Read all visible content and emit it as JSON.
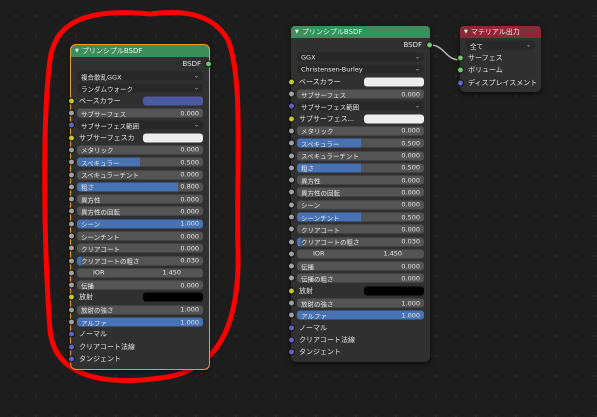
{
  "node1": {
    "title": "プリンシプルBSDF",
    "output": "BSDF",
    "dropdowns": [
      "複合散乱GGX",
      "ランダムウォーク"
    ],
    "rows": [
      {
        "type": "color",
        "label": "ベースカラー",
        "color": "#4d5aa0",
        "socket": "yellow"
      },
      {
        "type": "value",
        "label": "サブサーフェス",
        "value": "0.000",
        "fill": 0,
        "socket": "grey"
      },
      {
        "type": "vector",
        "label": "サブサーフェス範囲",
        "socket": "purple"
      },
      {
        "type": "color",
        "label": "サブサーフェスカ",
        "color": "#eeeeee",
        "socket": "yellow"
      },
      {
        "type": "value",
        "label": "メタリック",
        "value": "0.000",
        "fill": 0,
        "socket": "grey"
      },
      {
        "type": "value",
        "label": "スペキュラー",
        "value": "0.500",
        "fill": 0.5,
        "socket": "grey"
      },
      {
        "type": "value",
        "label": "スペキュラーチント",
        "value": "0.000",
        "fill": 0,
        "socket": "grey"
      },
      {
        "type": "value",
        "label": "粗さ",
        "value": "0.800",
        "fill": 0.8,
        "socket": "grey"
      },
      {
        "type": "value",
        "label": "異方性",
        "value": "0.000",
        "fill": 0,
        "socket": "grey"
      },
      {
        "type": "value",
        "label": "異方性の回転",
        "value": "0.000",
        "fill": 0,
        "socket": "grey"
      },
      {
        "type": "value",
        "label": "シーン",
        "value": "1.000",
        "fill": 1,
        "socket": "grey"
      },
      {
        "type": "value",
        "label": "シーンチント",
        "value": "0.000",
        "fill": 0,
        "socket": "grey"
      },
      {
        "type": "value",
        "label": "クリアコート",
        "value": "0.000",
        "fill": 0,
        "socket": "grey"
      },
      {
        "type": "value",
        "label": "クリアコートの粗さ",
        "value": "0.030",
        "fill": 0.03,
        "socket": "grey"
      },
      {
        "type": "value",
        "label": "IOR",
        "value": "1.450",
        "fill": 0,
        "socket": "grey",
        "center": true
      },
      {
        "type": "value",
        "label": "伝播",
        "value": "0.000",
        "fill": 0,
        "socket": "grey"
      },
      {
        "type": "color",
        "label": "放射",
        "color": "#000000",
        "socket": "yellow"
      },
      {
        "type": "value",
        "label": "放射の強さ",
        "value": "1.000",
        "fill": 0,
        "socket": "grey"
      },
      {
        "type": "value",
        "label": "アルファ",
        "value": "1.000",
        "fill": 1,
        "socket": "grey"
      },
      {
        "type": "plain",
        "label": "ノーマル",
        "socket": "purple"
      },
      {
        "type": "plain",
        "label": "クリアコート法線",
        "socket": "purple"
      },
      {
        "type": "plain",
        "label": "タンジェント",
        "socket": "purple"
      }
    ]
  },
  "node2": {
    "title": "プリンシプルBSDF",
    "output": "BSDF",
    "dropdowns": [
      "GGX",
      "Christensen-Burley"
    ],
    "rows": [
      {
        "type": "color",
        "label": "ベースカラー",
        "color": "#eeeeee",
        "socket": "yellow"
      },
      {
        "type": "value",
        "label": "サブサーフェス",
        "value": "0.000",
        "fill": 0,
        "socket": "grey"
      },
      {
        "type": "vector",
        "label": "サブサーフェス範囲",
        "socket": "purple"
      },
      {
        "type": "color",
        "label": "サブサーフェス...",
        "color": "#eeeeee",
        "socket": "yellow"
      },
      {
        "type": "value",
        "label": "メタリック",
        "value": "0.000",
        "fill": 0,
        "socket": "grey"
      },
      {
        "type": "value",
        "label": "スペキュラー",
        "value": "0.500",
        "fill": 0.5,
        "socket": "grey"
      },
      {
        "type": "value",
        "label": "スペキュラーチント",
        "value": "0.000",
        "fill": 0,
        "socket": "grey"
      },
      {
        "type": "value",
        "label": "粗さ",
        "value": "0.500",
        "fill": 0.5,
        "socket": "grey"
      },
      {
        "type": "value",
        "label": "異方性",
        "value": "0.000",
        "fill": 0,
        "socket": "grey"
      },
      {
        "type": "value",
        "label": "異方性の回転",
        "value": "0.000",
        "fill": 0,
        "socket": "grey"
      },
      {
        "type": "value",
        "label": "シーン",
        "value": "0.000",
        "fill": 0,
        "socket": "grey"
      },
      {
        "type": "value",
        "label": "シーンチント",
        "value": "0.500",
        "fill": 0.5,
        "socket": "grey"
      },
      {
        "type": "value",
        "label": "クリアコート",
        "value": "0.000",
        "fill": 0,
        "socket": "grey"
      },
      {
        "type": "value",
        "label": "クリアコートの粗さ",
        "value": "0.030",
        "fill": 0.03,
        "socket": "grey"
      },
      {
        "type": "value",
        "label": "IOR",
        "value": "1.450",
        "fill": 0,
        "socket": "grey",
        "center": true
      },
      {
        "type": "value",
        "label": "伝播",
        "value": "0.000",
        "fill": 0,
        "socket": "grey"
      },
      {
        "type": "value",
        "label": "伝播の粗さ",
        "value": "0.000",
        "fill": 0,
        "socket": "grey"
      },
      {
        "type": "color",
        "label": "放射",
        "color": "#000000",
        "socket": "yellow"
      },
      {
        "type": "value",
        "label": "放射の強さ",
        "value": "1.000",
        "fill": 0,
        "socket": "grey"
      },
      {
        "type": "value",
        "label": "アルファ",
        "value": "1.000",
        "fill": 1,
        "socket": "grey"
      },
      {
        "type": "plain",
        "label": "ノーマル",
        "socket": "purple"
      },
      {
        "type": "plain",
        "label": "クリアコート法線",
        "socket": "purple"
      },
      {
        "type": "plain",
        "label": "タンジェント",
        "socket": "purple"
      }
    ]
  },
  "node3": {
    "title": "マテリアル出力",
    "dropdown": "全て",
    "inputs": [
      {
        "label": "サーフェス",
        "socket": "green"
      },
      {
        "label": "ボリューム",
        "socket": "green"
      },
      {
        "label": "ディスプレイスメント",
        "socket": "purple"
      }
    ]
  },
  "colors": {
    "shader_header": "#3c8f5c",
    "output_header": "#8a2a36",
    "annotation": "#ff0000",
    "accent": "#4772b3"
  }
}
